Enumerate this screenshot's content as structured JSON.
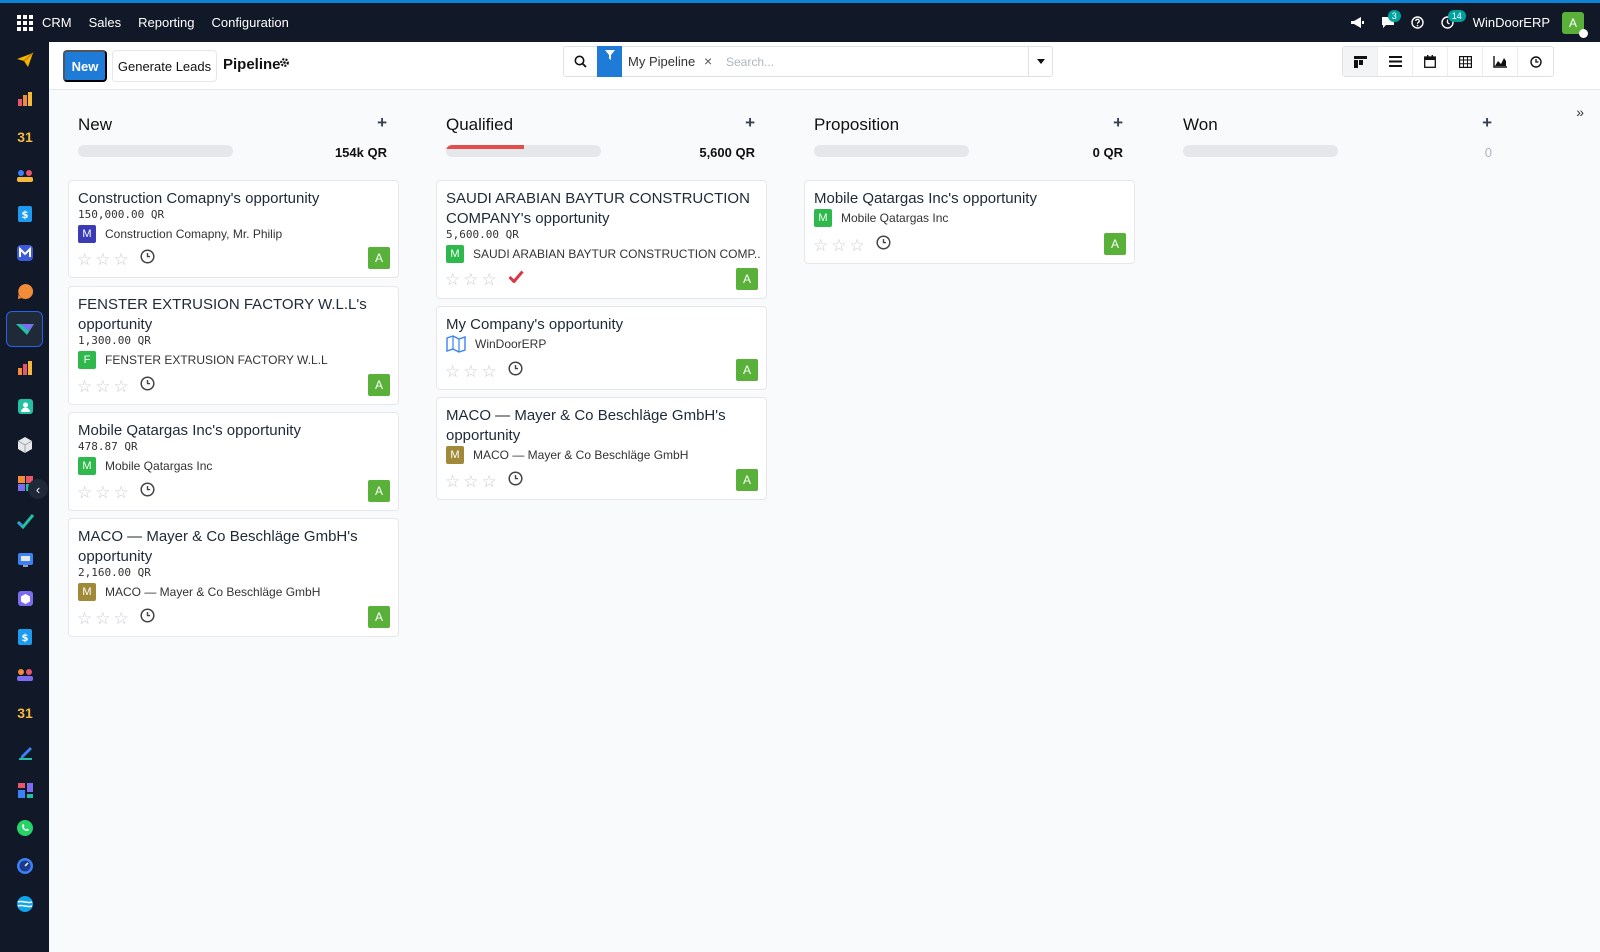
{
  "topbar": {
    "app_name": "CRM",
    "menu": [
      "Sales",
      "Reporting",
      "Configuration"
    ],
    "messages_badge": "3",
    "activities_badge": "14",
    "company": "WinDoorERP",
    "user_initial": "A"
  },
  "control": {
    "new_label": "New",
    "generate_leads_label": "Generate Leads",
    "title": "Pipeline",
    "search": {
      "facet": "My Pipeline",
      "placeholder": "Search..."
    },
    "views": [
      "kanban",
      "list",
      "calendar",
      "pivot",
      "graph",
      "activity"
    ]
  },
  "stages": [
    {
      "name": "New",
      "total": "154k QR",
      "progress": 0,
      "cards": [
        {
          "title": "Construction Comapny's opportunity",
          "amount": "150,000.00 QR",
          "partner_initial": "M",
          "partner": "Construction Comapny, Mr. Philip",
          "assignee": "A"
        },
        {
          "title": "FENSTER EXTRUSION FACTORY W.L.L's opportunity",
          "amount": "1,300.00 QR",
          "partner_initial": "F",
          "partner": "FENSTER EXTRUSION FACTORY W.L.L",
          "assignee": "A"
        },
        {
          "title": "Mobile Qatargas Inc's opportunity",
          "amount": "478.87 QR",
          "partner_initial": "M",
          "partner": "Mobile Qatargas Inc",
          "assignee": "A"
        },
        {
          "title": "MACO — Mayer & Co Beschläge GmbH's opportunity",
          "amount": "2,160.00 QR",
          "partner_initial": "M",
          "partner": "MACO — Mayer & Co Beschläge GmbH",
          "assignee": "A"
        }
      ]
    },
    {
      "name": "Qualified",
      "total": "5,600 QR",
      "progress": 0.5,
      "cards": [
        {
          "title": "SAUDI ARABIAN BAYTUR CONSTRUCTION COMPANY's opportunity",
          "amount": "5,600.00 QR",
          "partner_initial": "M",
          "partner": "SAUDI ARABIAN BAYTUR CONSTRUCTION COMP...",
          "assignee": "A"
        },
        {
          "title": "My Company's opportunity",
          "amount": "",
          "partner_initial": "",
          "partner": "WinDoorERP",
          "assignee": "A"
        },
        {
          "title": "MACO — Mayer & Co Beschläge GmbH's opportunity",
          "amount": "",
          "partner_initial": "M",
          "partner": "MACO — Mayer & Co Beschläge GmbH",
          "assignee": "A"
        }
      ]
    },
    {
      "name": "Proposition",
      "total": "0 QR",
      "progress": 0,
      "cards": [
        {
          "title": "Mobile Qatargas Inc's opportunity",
          "amount": "",
          "partner_initial": "M",
          "partner": "Mobile Qatargas Inc",
          "assignee": "A"
        }
      ]
    },
    {
      "name": "Won",
      "total": "0",
      "progress": 0,
      "cards": []
    }
  ],
  "colors": {
    "primary": "#1f7bd8",
    "avatar_green": "#5ab13a",
    "progress_red": "#e54d4d"
  }
}
